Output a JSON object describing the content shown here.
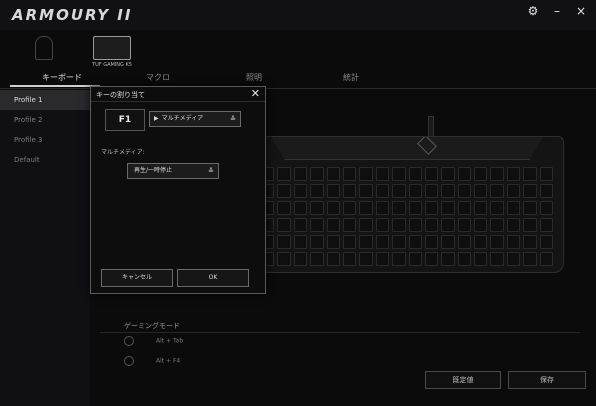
{
  "app": {
    "title": "ARMOURY II"
  },
  "window_controls": {
    "settings": "⚙",
    "minimize": "–",
    "close": "×"
  },
  "devices": [
    {
      "label": "",
      "active": false
    },
    {
      "label": "TUF GAMING K5",
      "active": true
    }
  ],
  "tabs": [
    {
      "label": "キーボード",
      "active": true
    },
    {
      "label": "マクロ",
      "active": false
    },
    {
      "label": "照明",
      "active": false
    },
    {
      "label": "統計",
      "active": false
    }
  ],
  "profiles": [
    {
      "label": "Profile 1",
      "active": true
    },
    {
      "label": "Profile 2",
      "active": false
    },
    {
      "label": "Profile 3",
      "active": false
    },
    {
      "label": "Default",
      "active": false
    }
  ],
  "gaming_mode": {
    "title": "ゲーミングモード",
    "options": [
      "Alt + Tab",
      "Alt + F4"
    ]
  },
  "footer": {
    "default_button": "既定値",
    "save_button": "保存"
  },
  "dialog": {
    "title": "キーの割り当て",
    "key": "F1",
    "type_select": "マルチメディア",
    "multimedia_label": "マルチメディア:",
    "multimedia_select": "再生/一時停止",
    "cancel_button": "キャンセル",
    "ok_button": "OK"
  }
}
